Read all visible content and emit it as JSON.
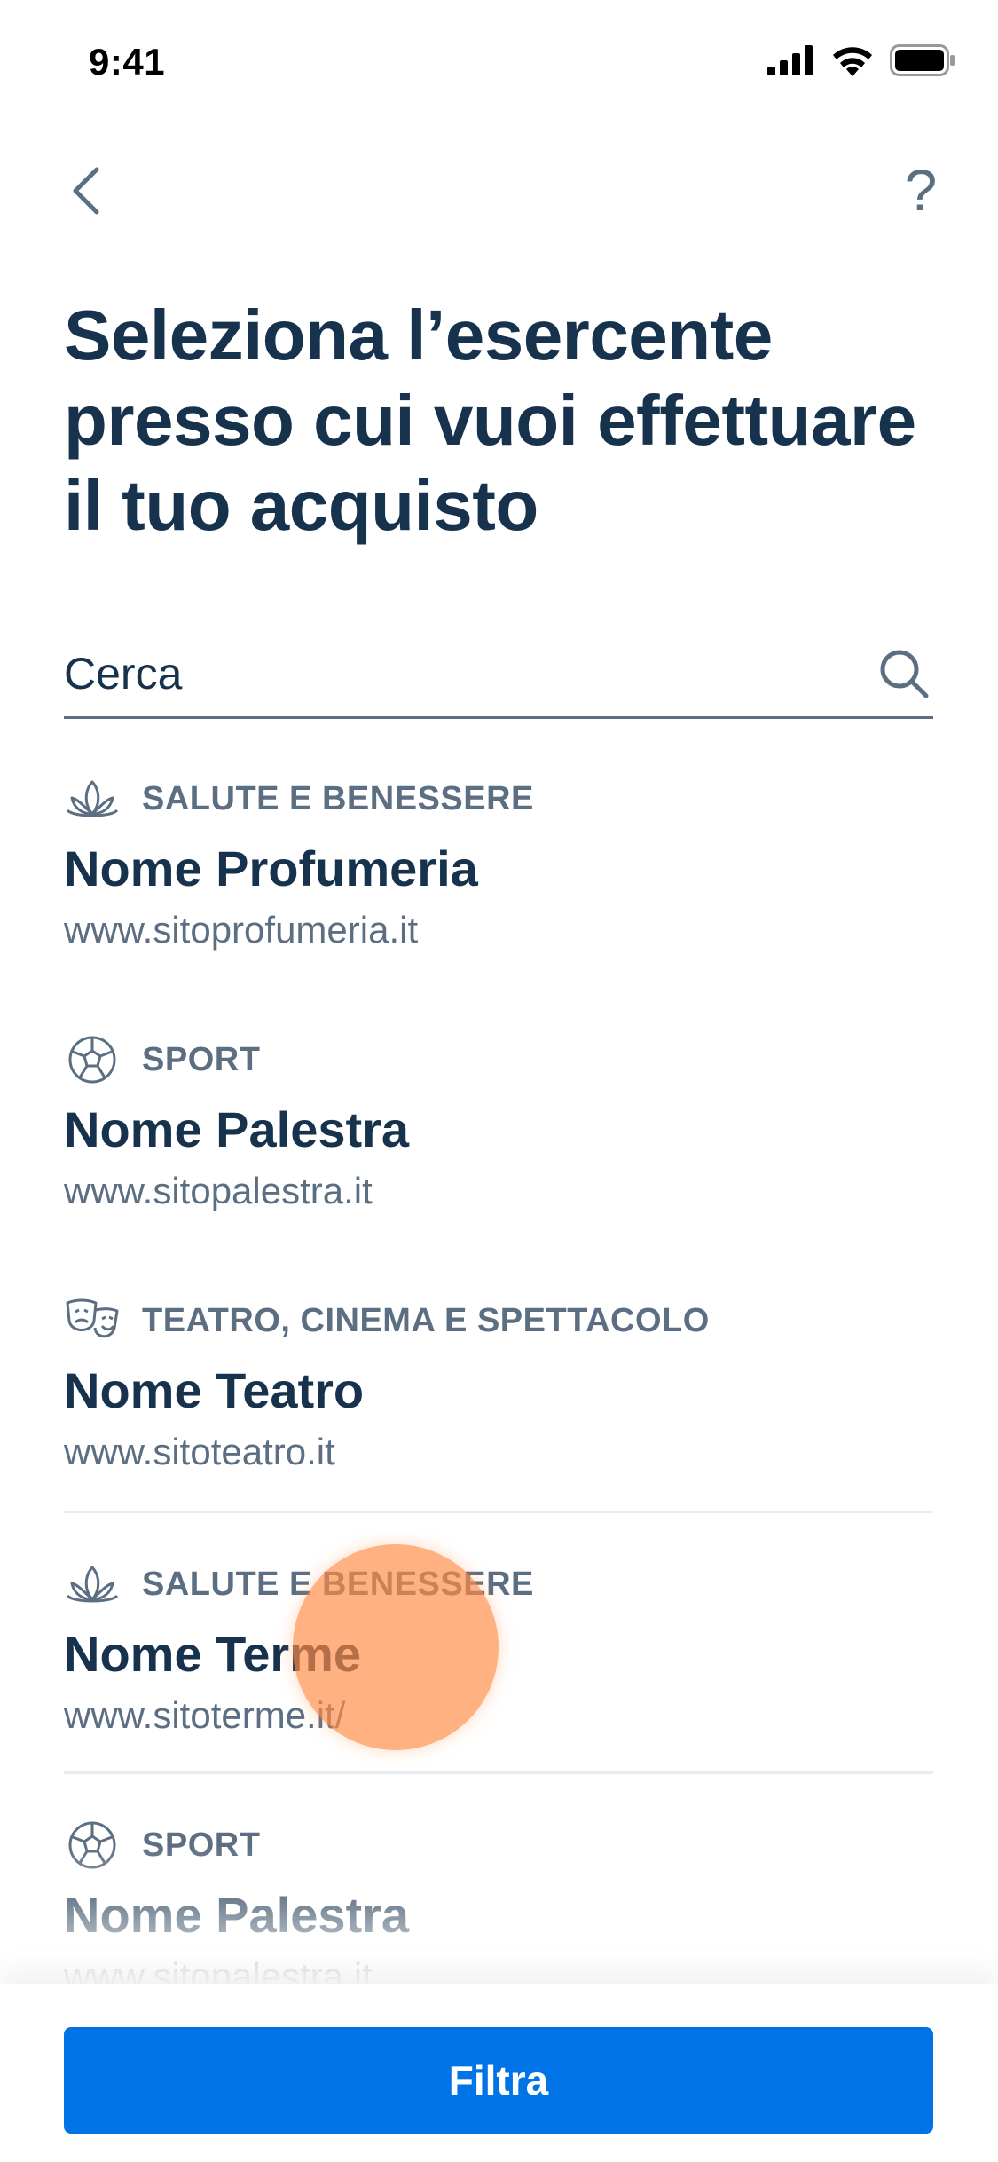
{
  "status_bar": {
    "time": "9:41"
  },
  "nav": {
    "help_label": "?"
  },
  "page": {
    "title": "Seleziona l’esercente presso cui vuoi effettuare il tuo acquisto"
  },
  "search": {
    "placeholder": "Cerca",
    "value": ""
  },
  "merchants": [
    {
      "category": "SALUTE E BENESSERE",
      "category_icon": "lotus-icon",
      "name": "Nome Profumeria",
      "url": "www.sitoprofumeria.it"
    },
    {
      "category": "SPORT",
      "category_icon": "soccer-ball-icon",
      "name": "Nome Palestra",
      "url": "www.sitopalestra.it"
    },
    {
      "category": "TEATRO, CINEMA E SPETTACOLO",
      "category_icon": "theater-masks-icon",
      "name": "Nome Teatro",
      "url": "www.sitoteatro.it"
    },
    {
      "category": "SALUTE E BENESSERE",
      "category_icon": "lotus-icon",
      "name": "Nome Terme",
      "url": "www.sitoterme.it/"
    },
    {
      "category": "SPORT",
      "category_icon": "soccer-ball-icon",
      "name": "Nome Palestra",
      "url": "www.sitopalestra.it"
    }
  ],
  "footer": {
    "filter_label": "Filtra"
  },
  "colors": {
    "primary": "#0073e6",
    "text_dark": "#17324d",
    "text_muted": "#5c6f82",
    "divider": "#e8ebf0",
    "touch": "#ff8c46"
  }
}
